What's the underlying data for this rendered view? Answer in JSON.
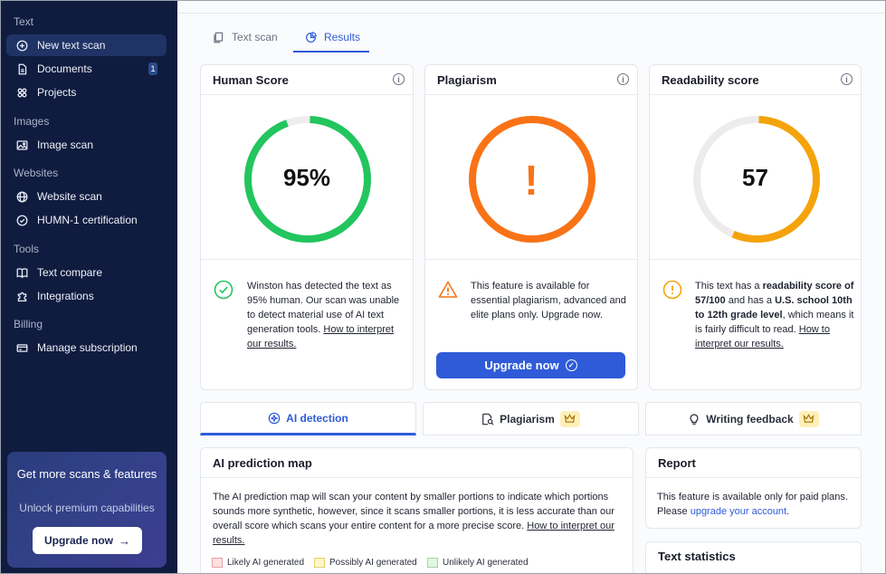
{
  "sidebar": {
    "sections": [
      {
        "title": "Text"
      },
      {
        "title": "Images"
      },
      {
        "title": "Websites"
      },
      {
        "title": "Tools"
      },
      {
        "title": "Billing"
      }
    ],
    "items": [
      {
        "label": "New text scan",
        "icon": "plus-circle-icon"
      },
      {
        "label": "Documents",
        "icon": "document-icon",
        "badge": "1"
      },
      {
        "label": "Projects",
        "icon": "grid-icon"
      },
      {
        "label": "Image scan",
        "icon": "image-icon"
      },
      {
        "label": "Website scan",
        "icon": "globe-icon"
      },
      {
        "label": "HUMN-1 certification",
        "icon": "check-badge-icon"
      },
      {
        "label": "Text compare",
        "icon": "book-icon"
      },
      {
        "label": "Integrations",
        "icon": "puzzle-icon"
      },
      {
        "label": "Manage subscription",
        "icon": "card-icon"
      }
    ],
    "promo": {
      "title": "Get more scans & features",
      "subtitle": "Unlock premium capabilities",
      "button": "Upgrade now"
    }
  },
  "tabs": [
    {
      "label": "Text scan",
      "active": false
    },
    {
      "label": "Results",
      "active": true
    }
  ],
  "cards": {
    "human": {
      "title": "Human Score",
      "value": "95%",
      "fraction": 0.95,
      "color": "#22c55e",
      "desc_text": "Winston has detected the text as 95% human. Our scan was unable to detect material use of AI text generation tools.",
      "link": "How to interpret our results."
    },
    "plagiarism": {
      "title": "Plagiarism",
      "value": "!",
      "color": "#f97316",
      "desc": "This feature is available for essential plagiarism, advanced and elite plans only. Upgrade now.",
      "button": "Upgrade now"
    },
    "readability": {
      "title": "Readability score",
      "value": "57",
      "fraction": 0.57,
      "color": "#f5a30b",
      "desc_1": "This text has a ",
      "desc_bold_1": "readability score of 57/100",
      "desc_2": " and has a ",
      "desc_bold_2": "U.S. school 10th to 12th grade level",
      "desc_3": ", which means it is fairly difficult to read.",
      "link": "How to interpret our results."
    }
  },
  "subtabs": [
    {
      "label": "AI detection",
      "active": true
    },
    {
      "label": "Plagiarism",
      "premium": true
    },
    {
      "label": "Writing feedback",
      "premium": true
    }
  ],
  "prediction_map": {
    "title": "AI prediction map",
    "desc": "The AI prediction map will scan your content by smaller portions to indicate which portions sounds more synthetic, however, since it scans smaller portions, it is less accurate than our overall score which scans your entire content for a more precise score.",
    "link": "How to interpret our results.",
    "legend": [
      {
        "label": "Likely AI generated",
        "fill": "#fde2e2",
        "border": "#e8a0a0"
      },
      {
        "label": "Possibly AI generated",
        "fill": "#fdf6cc",
        "border": "#e3cf6b"
      },
      {
        "label": "Unlikely AI generated",
        "fill": "#e2f7e2",
        "border": "#9ed89e"
      }
    ]
  },
  "report": {
    "title": "Report",
    "desc": "This feature is available only for paid plans. Please ",
    "link": "upgrade your account",
    "desc_end": "."
  },
  "text_stats": {
    "title": "Text statistics"
  }
}
